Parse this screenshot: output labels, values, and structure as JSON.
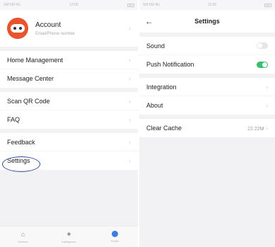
{
  "left": {
    "status": {
      "left": "SM 5M 4G",
      "center": "12:00"
    },
    "account": {
      "title": "Account",
      "subtitle": "Email/Phone number"
    },
    "group1": [
      "Home Management",
      "Message Center"
    ],
    "group2": [
      "Scan QR Code",
      "FAQ"
    ],
    "group3": [
      "Feedback",
      "Settings"
    ],
    "tabs": [
      {
        "label": "Devices",
        "icon": "home-icon"
      },
      {
        "label": "Intelligence",
        "icon": "sun-icon"
      },
      {
        "label": "Profile",
        "icon": "profile-icon"
      }
    ]
  },
  "right": {
    "status": {
      "left": "SM 5M 4G",
      "center": "12:00"
    },
    "title": "Settings",
    "group1": [
      {
        "label": "Sound",
        "toggle": "off"
      },
      {
        "label": "Push Notification",
        "toggle": "on"
      }
    ],
    "group2": [
      "Integration",
      "About"
    ],
    "group3": {
      "label": "Clear Cache",
      "value": "22.22M"
    }
  },
  "colors": {
    "accent": "#3bbf6e",
    "avatar": "#e8542c",
    "tab_active": "#3c7fe0",
    "highlight": "#2f4f9a"
  }
}
